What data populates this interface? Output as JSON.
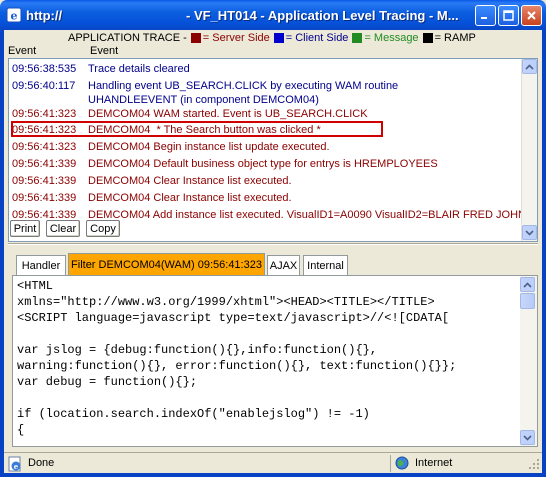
{
  "window": {
    "title_left": "http://",
    "title_main": "- VF_HT014 - Application Level Tracing - M..."
  },
  "legend": {
    "caption": "APPLICATION TRACE -",
    "server": "= Server Side",
    "client": "= Client Side",
    "message": "= Message",
    "ramp": "= RAMP",
    "colors": {
      "server": "#8b0000",
      "client": "#00008b",
      "message": "#228b22",
      "ramp": "#000000"
    }
  },
  "columns": {
    "event_time": "Event",
    "event": "Event"
  },
  "events": [
    {
      "time": "09:56:38:535",
      "text": "Trace details cleared",
      "side": "client"
    },
    {
      "time": "09:56:40:117",
      "text": "Handling event UB_SEARCH.CLICK by executing WAM routine UHANDLEEVENT (in component DEMCOM04)",
      "side": "client"
    },
    {
      "time": "09:56:41:323",
      "text": "DEMCOM04 WAM started. Event is UB_SEARCH.CLICK",
      "side": "server"
    },
    {
      "time": "09:56:41:323",
      "text": "DEMCOM04  * The Search button was clicked *",
      "side": "server"
    },
    {
      "time": "09:56:41:323",
      "text": "DEMCOM04 Begin instance list update executed.",
      "side": "server"
    },
    {
      "time": "09:56:41:339",
      "text": "DEMCOM04 Default business object type for entrys is HREMPLOYEES",
      "side": "server"
    },
    {
      "time": "09:56:41:339",
      "text": "DEMCOM04 Clear Instance list executed.",
      "side": "server"
    },
    {
      "time": "09:56:41:339",
      "text": "DEMCOM04 Clear Instance list executed.",
      "side": "server"
    },
    {
      "time": "09:56:41:339",
      "text": "DEMCOM04 Add instance list executed. VisualID1=A0090 VisualID2=BLAIR FRED JOHN",
      "side": "server"
    }
  ],
  "buttons": {
    "print": "Print",
    "clear": "Clear",
    "copy": "Copy"
  },
  "tabs": [
    {
      "label": "Handler",
      "active": false
    },
    {
      "label": "Filter DEMCOM04(WAM) 09:56:41:323",
      "active": true
    },
    {
      "label": "AJAX",
      "active": false
    },
    {
      "label": "Internal",
      "active": false
    }
  ],
  "code": "<HTML\nxmlns=\"http://www.w3.org/1999/xhtml\"><HEAD><TITLE></TITLE>\n<SCRIPT language=javascript type=text/javascript>//<![CDATA[\n\nvar jslog = {debug:function(){},info:function(){},\nwarning:function(){}, error:function(){}, text:function(){}};\nvar debug = function(){};\n\nif (location.search.indexOf(\"enablejslog\") != -1)\n{",
  "status": {
    "text": "Done",
    "zone": "Internet"
  }
}
